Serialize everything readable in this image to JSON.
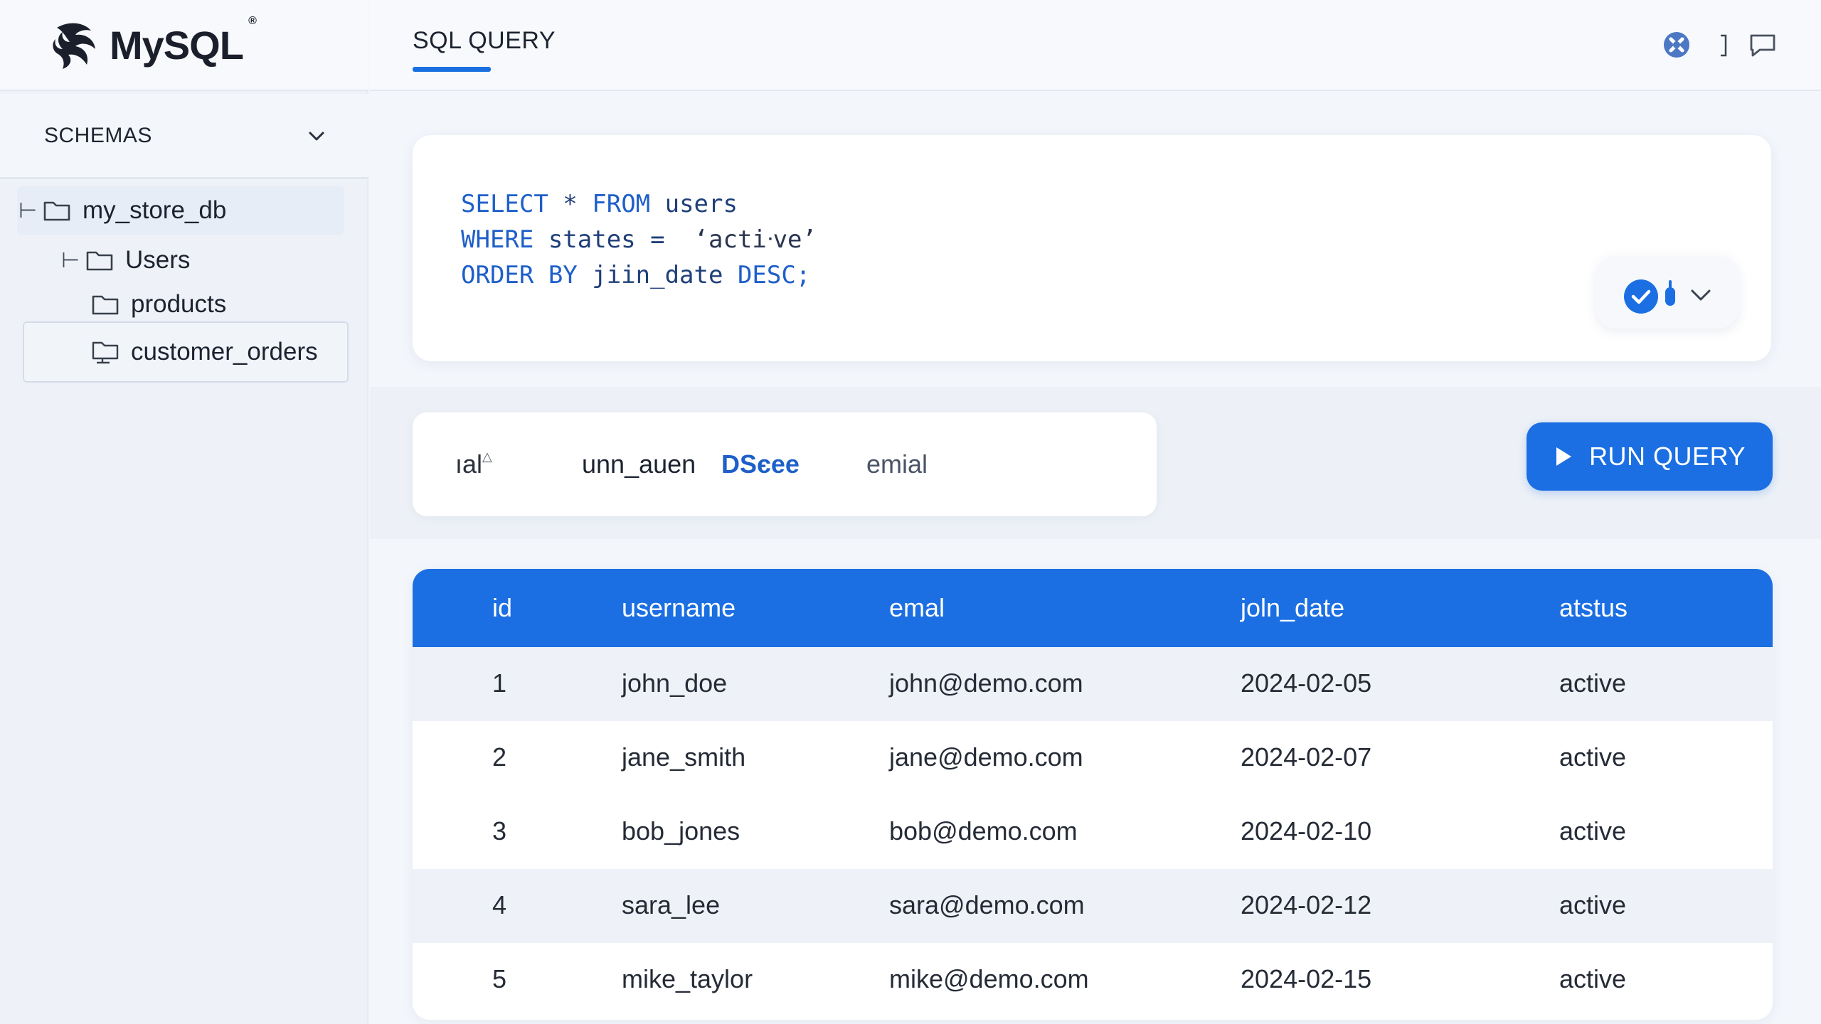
{
  "app": {
    "logo_text": "MySQL",
    "logo_reg": "®"
  },
  "sidebar": {
    "schemas_label": "SCHEMAS",
    "tree": {
      "db": "my_store_db",
      "users": "Users",
      "products": "products",
      "orders": "customer_orders"
    }
  },
  "tabs": {
    "active": "SQL QUERY"
  },
  "editor": {
    "line1": {
      "kw1": "SELECT",
      "rest1": " * ",
      "kw2": "FROM",
      "rest2": " users"
    },
    "line2": {
      "kw1": "WHERE",
      "rest1": " states =  ",
      "str": "‘actiᐧve’"
    },
    "line3": {
      "kw1": "ORDER BY",
      "rest1": " jiin_date ",
      "kw2": "DESC;"
    }
  },
  "sortbar": {
    "item1": "ıal",
    "item1_mark": "△",
    "item2": "unn_auen",
    "item3": "DSєee",
    "item4": "emial"
  },
  "run_button": {
    "label": "RUN QUERY"
  },
  "colors": {
    "accent": "#1b6fe3",
    "keyword": "#1e5fc9",
    "row_alt": "#eef2f8"
  },
  "table": {
    "headers": [
      "id",
      "username",
      "emal",
      "joln_date",
      "atstus"
    ],
    "rows": [
      [
        "1",
        "john_doe",
        "john@demo.com",
        "2024-02-05",
        "active"
      ],
      [
        "2",
        "jane_smith",
        "jane@demo.com",
        "2024-02-07",
        "active"
      ],
      [
        "3",
        "bob_jones",
        "bob@demo.com",
        "2024-02-10",
        "active"
      ],
      [
        "4",
        "sara_lee",
        "sara@demo.com",
        "2024-02-12",
        "active"
      ],
      [
        "5",
        "mike_taylor",
        "mike@demo.com",
        "2024-02-15",
        "active"
      ]
    ]
  }
}
